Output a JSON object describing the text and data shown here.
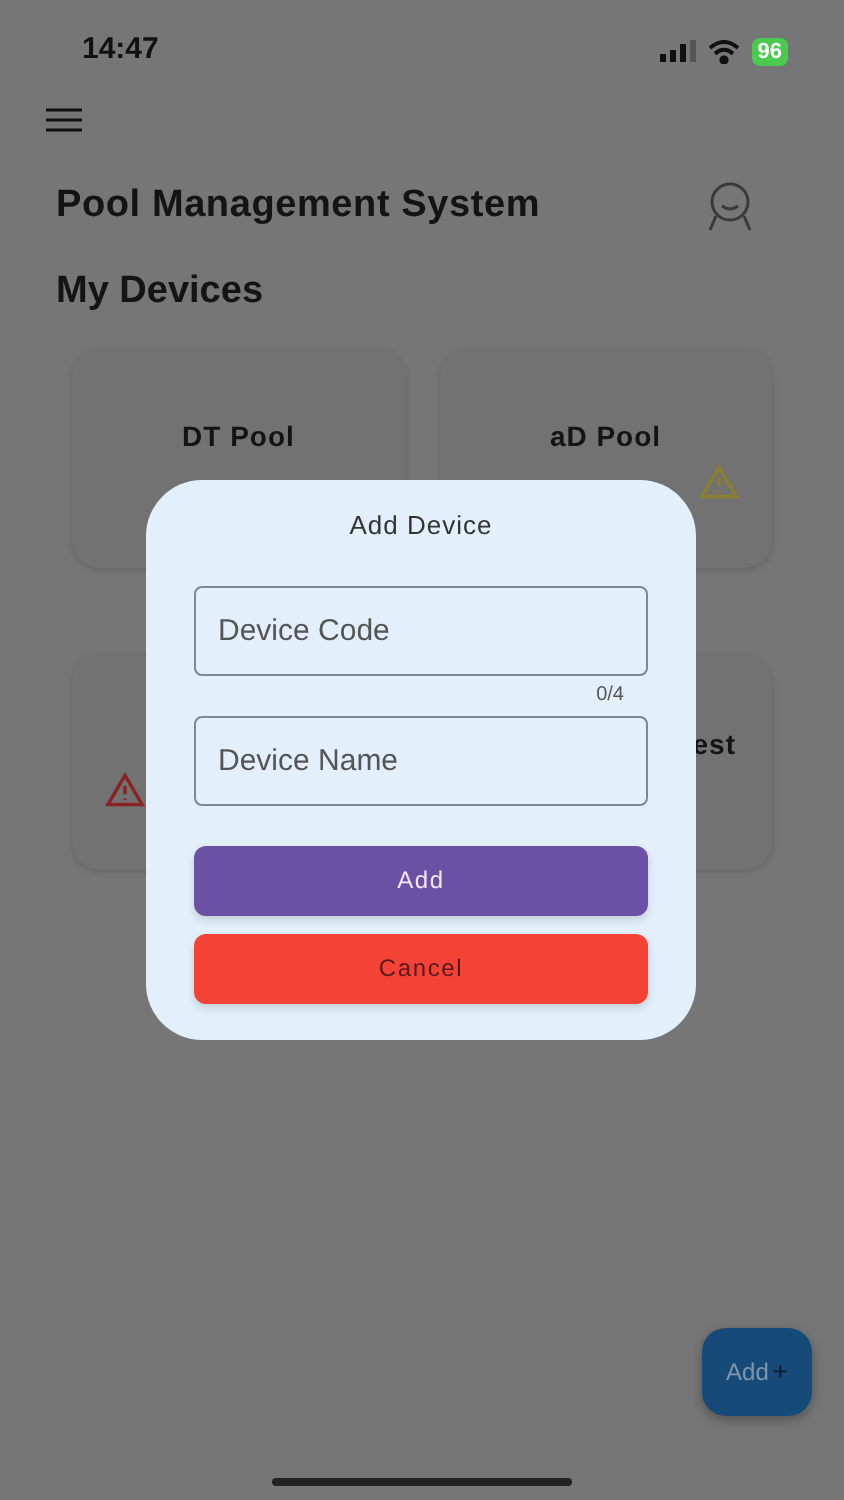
{
  "status_bar": {
    "time": "14:47",
    "battery": "96"
  },
  "header": {
    "title": "Pool Management System"
  },
  "section_title": "My Devices",
  "devices": [
    {
      "kind": "full",
      "name": "DT Pool"
    },
    {
      "kind": "full",
      "name": "aD Pool",
      "color": "#8a8030"
    },
    {
      "kind": "hidden",
      "color": "#8a2424"
    },
    {
      "kind": "partial",
      "name": "est"
    }
  ],
  "dialog": {
    "title": "Add Device",
    "fields": [
      {
        "placeholder": "Device Code",
        "counter": "0/4"
      },
      {
        "placeholder": "Device Name"
      }
    ],
    "buttons": [
      {
        "kind": "primary",
        "label": "Add"
      },
      {
        "kind": "danger",
        "label": "Cancel"
      }
    ]
  },
  "fab": {
    "label": "Add",
    "icon": "+"
  }
}
